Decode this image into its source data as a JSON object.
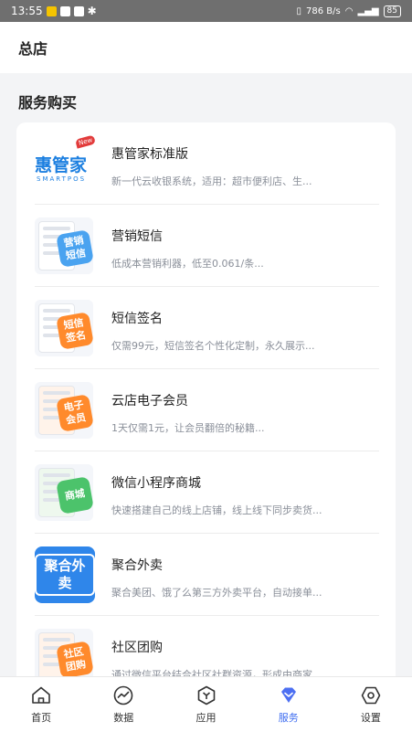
{
  "status_bar": {
    "time": "13:55",
    "net_speed": "786 B/s",
    "battery": "85"
  },
  "header": {
    "title": "总店"
  },
  "section": {
    "title": "服务购买"
  },
  "services": [
    {
      "name": "惠管家标准版",
      "desc": "新一代云收银系统，适用：超市便利店、生..."
    },
    {
      "name": "营销短信",
      "desc": "低成本营销利器，低至0.061/条..."
    },
    {
      "name": "短信签名",
      "desc": "仅需99元，短信签名个性化定制，永久展示..."
    },
    {
      "name": "云店电子会员",
      "desc": "1天仅需1元，让会员翻倍的秘籍..."
    },
    {
      "name": "微信小程序商城",
      "desc": "快速搭建自己的线上店铺，线上线下同步卖货..."
    },
    {
      "name": "聚合外卖",
      "desc": "聚合美团、饿了么第三方外卖平台，自动接单..."
    },
    {
      "name": "社区团购",
      "desc": "通过微信平台结合社区社群资源，形成由商家..."
    }
  ],
  "logos": {
    "hgj_main": "惠管家",
    "hgj_sub": "SMARTPOS",
    "hgj_new": "New",
    "badge_sms": "营销短信",
    "badge_sign": "短信签名",
    "badge_member": "电子会员",
    "badge_mall": "商城",
    "badge_takeout": "聚合外卖",
    "badge_group": "社区团购"
  },
  "tabs": [
    {
      "label": "首页",
      "icon": "home-icon"
    },
    {
      "label": "数据",
      "icon": "chart-icon"
    },
    {
      "label": "应用",
      "icon": "apps-icon"
    },
    {
      "label": "服务",
      "icon": "diamond-icon",
      "active": true
    },
    {
      "label": "设置",
      "icon": "gear-icon"
    }
  ],
  "colors": {
    "accent": "#3f6df0",
    "background": "#f3f4f6"
  }
}
